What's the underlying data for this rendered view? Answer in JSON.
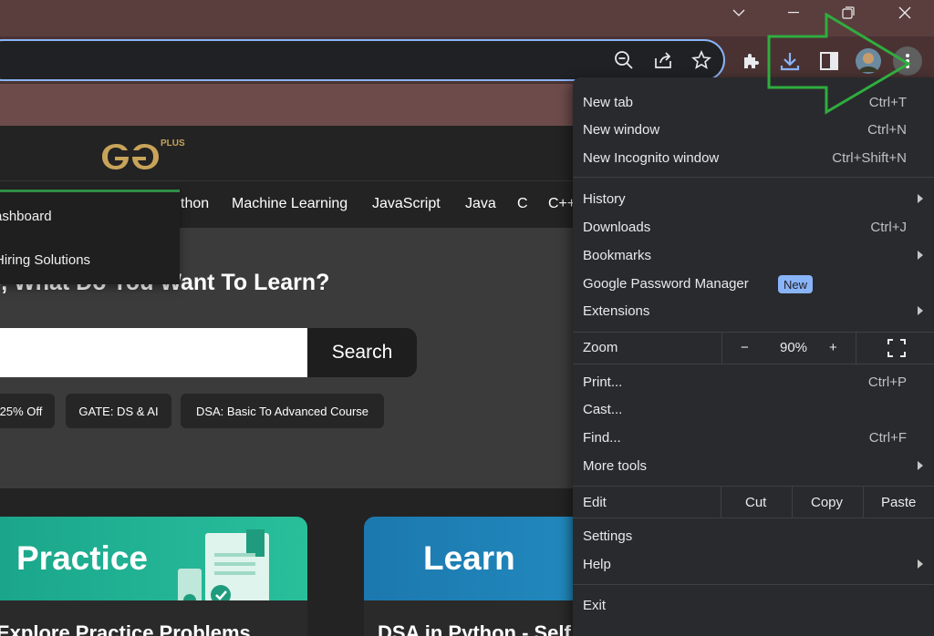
{
  "page": {
    "nav": [
      "thon",
      "Machine Learning",
      "JavaScript",
      "Java",
      "C",
      "C++"
    ],
    "dropdown": [
      "ashboard",
      "Hiring Solutions"
    ],
    "hero_title": "o, What Do You Want To Learn?",
    "search_button": "Search",
    "chips": [
      "25% Off",
      "GATE: DS & AI",
      "DSA: Basic To Advanced Course"
    ],
    "cards": [
      {
        "title": "Practice",
        "subtitle": "Explore Practice Problems"
      },
      {
        "title": "Learn",
        "subtitle": "DSA in Python - Self Paced"
      }
    ],
    "logo_tag": "PLUS"
  },
  "menu": {
    "new_tab": {
      "label": "New tab",
      "shortcut": "Ctrl+T"
    },
    "new_window": {
      "label": "New window",
      "shortcut": "Ctrl+N"
    },
    "incognito": {
      "label": "New Incognito window",
      "shortcut": "Ctrl+Shift+N"
    },
    "history": {
      "label": "History"
    },
    "downloads": {
      "label": "Downloads",
      "shortcut": "Ctrl+J"
    },
    "bookmarks": {
      "label": "Bookmarks"
    },
    "password_manager": {
      "label": "Google Password Manager",
      "badge": "New"
    },
    "extensions": {
      "label": "Extensions"
    },
    "zoom": {
      "label": "Zoom",
      "minus": "−",
      "value": "90%",
      "plus": "+"
    },
    "print": {
      "label": "Print...",
      "shortcut": "Ctrl+P"
    },
    "cast": {
      "label": "Cast..."
    },
    "find": {
      "label": "Find...",
      "shortcut": "Ctrl+F"
    },
    "more_tools": {
      "label": "More tools"
    },
    "edit": {
      "label": "Edit",
      "cut": "Cut",
      "copy": "Copy",
      "paste": "Paste"
    },
    "settings": {
      "label": "Settings"
    },
    "help": {
      "label": "Help"
    },
    "exit": {
      "label": "Exit"
    }
  },
  "colors": {
    "accent": "#8ab4f8",
    "highlight": "#2fad3f",
    "brand_green": "#2f8d46"
  },
  "icons": [
    "chevron-down-icon",
    "minimize-icon",
    "restore-icon",
    "close-icon",
    "zoom-out-icon",
    "share-icon",
    "star-icon",
    "puzzle-icon",
    "download-icon",
    "side-panel-icon",
    "avatar",
    "kebab-menu-icon",
    "fullscreen-icon"
  ]
}
